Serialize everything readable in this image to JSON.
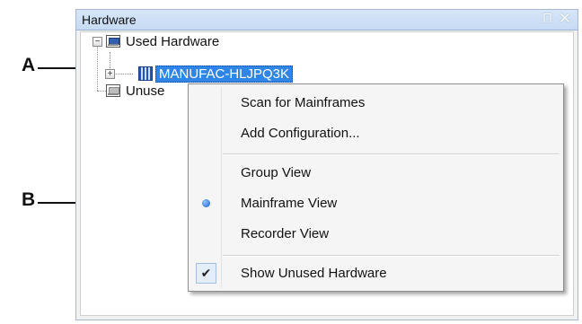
{
  "callouts": {
    "a": "A",
    "b": "B"
  },
  "panel": {
    "title": "Hardware",
    "pin_icon": "pin-icon",
    "close_icon": "close-icon",
    "pin_glyph": "Π",
    "close_glyph": "✕"
  },
  "tree": {
    "collapse_glyph": "−",
    "expand_glyph": "+",
    "used_hardware": "Used Hardware",
    "mainframe": "MANUFAC-HLJPQ3K",
    "unused_partial": "Unuse"
  },
  "menu": {
    "items": [
      {
        "label": "Scan for Mainframes"
      },
      {
        "label": "Add Configuration..."
      },
      {
        "label": "Group View"
      },
      {
        "label": "Mainframe View"
      },
      {
        "label": "Recorder View"
      },
      {
        "label": "Show Unused Hardware"
      }
    ],
    "selected_view": "Mainframe View",
    "show_unused_checked": true,
    "check_glyph": "✔"
  },
  "colors": {
    "selection": "#2f86e6",
    "header": "#c6dbf3",
    "radio": "#1460c7"
  }
}
